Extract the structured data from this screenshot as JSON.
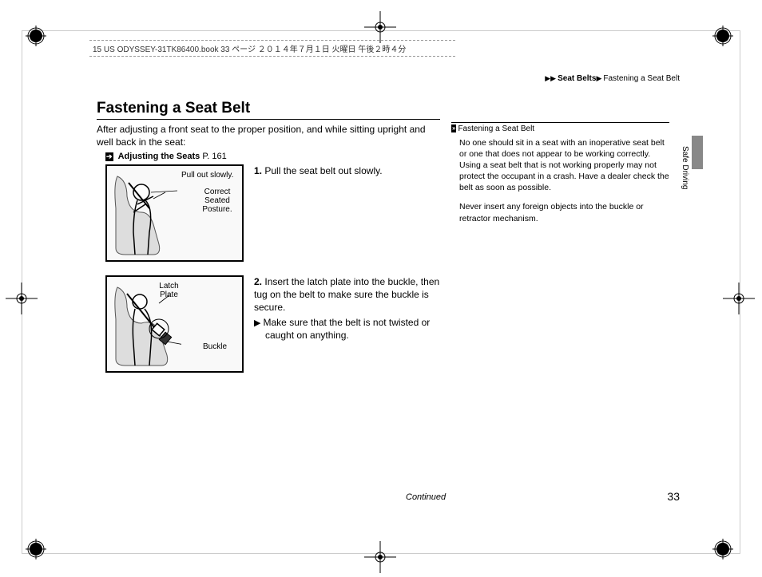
{
  "header_strip": "15 US ODYSSEY-31TK86400.book  33 ページ  ２０１４年７月１日  火曜日  午後２時４分",
  "breadcrumb": {
    "seg1": "Seat Belts",
    "seg2": "Fastening a Seat Belt"
  },
  "title": "Fastening a Seat Belt",
  "intro": "After adjusting a front seat to the proper position, and while sitting upright and well back in the seat:",
  "xref": {
    "label": "Adjusting the Seats",
    "page": "P. 161"
  },
  "fig1": {
    "label1": "Pull out slowly.",
    "label2": "Correct Seated Posture."
  },
  "fig2": {
    "label1": "Latch Plate",
    "label2": "Buckle"
  },
  "step1": {
    "num": "1.",
    "text": "Pull the seat belt out slowly."
  },
  "step2": {
    "num": "2.",
    "text": "Insert the latch plate into the buckle, then tug on the belt to make sure the buckle is secure.",
    "sub": "Make sure that the belt is not twisted or caught on anything."
  },
  "sidebox": {
    "head": "Fastening a Seat Belt",
    "p1": "No one should sit in a seat with an inoperative seat belt or one that does not appear to be working correctly. Using a seat belt that is not working properly may not protect the occupant in a crash. Have a dealer check the belt as soon as possible.",
    "p2": "Never insert any foreign objects into the buckle or retractor mechanism."
  },
  "side_tab": "Safe Driving",
  "continued": "Continued",
  "page_number": "33"
}
